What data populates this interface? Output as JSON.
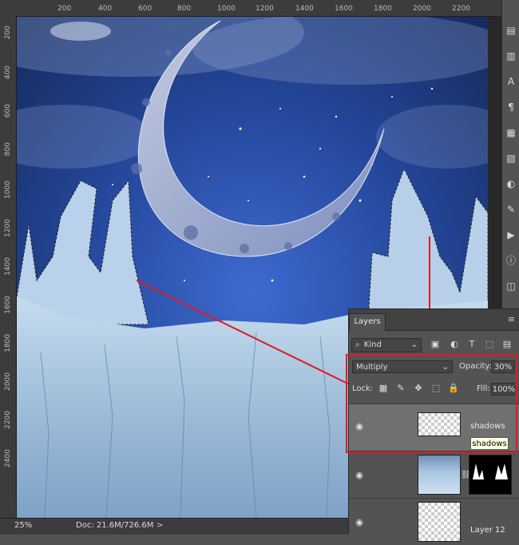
{
  "ruler": {
    "top_labels": [
      "200",
      "400",
      "600",
      "800",
      "1000",
      "1200",
      "1400",
      "1600",
      "1800",
      "2000",
      "2200"
    ],
    "left_labels": [
      "200",
      "400",
      "600",
      "800",
      "1000",
      "1200",
      "1400",
      "1600",
      "1800",
      "2000",
      "2200",
      "2400"
    ]
  },
  "status": {
    "zoom": "25%",
    "doc": "Doc: 21.6M/726.6M",
    "arrow": ">"
  },
  "layers_panel": {
    "tab": "Layers",
    "menu_icon": "≡",
    "filter": {
      "kind_label": "Kind",
      "icons": [
        "image-filter-icon",
        "adjustment-filter-icon",
        "type-filter-icon",
        "shape-filter-icon",
        "smart-object-filter-icon"
      ]
    },
    "blend_mode": "Multiply",
    "opacity_label": "Opacity:",
    "opacity_value": "30%",
    "lock_label": "Lock:",
    "fill_label": "Fill:",
    "fill_value": "100%",
    "layers": [
      {
        "name": "shadows",
        "selected": true,
        "tooltip": "shadows"
      },
      {
        "name": "",
        "selected": false
      },
      {
        "name": "Layer 12",
        "selected": false
      }
    ]
  },
  "colors": {
    "highlight": "#e01b24",
    "panel": "#535353",
    "ruler": "#3c3c3c"
  }
}
